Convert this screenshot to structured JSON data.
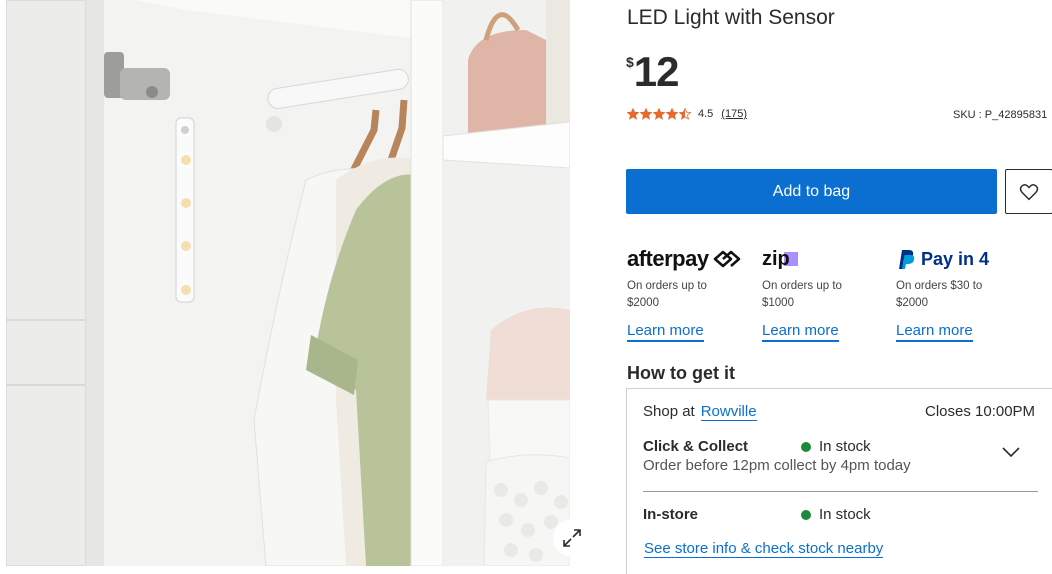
{
  "product": {
    "title": "LED Light with Sensor",
    "price_currency": "$",
    "price_amount": "12",
    "rating": "4.5",
    "rating_score": 4.5,
    "rating_count": "(175)",
    "sku": "SKU : P_42895831",
    "image_alt": "Wardrobe interior with LED sensor light bar"
  },
  "actions": {
    "add_to_bag_label": "Add to bag",
    "wishlist_icon": "heart-icon",
    "expand_icon": "expand-icon"
  },
  "payments": [
    {
      "provider": "afterpay",
      "terms_line1": "On orders up to",
      "terms_line2": "$2000",
      "link": "Learn more"
    },
    {
      "provider": "zip",
      "terms_line1": "On orders up to",
      "terms_line2": "$1000",
      "link": "Learn more"
    },
    {
      "provider": "paypal",
      "logo_text": "Pay in 4",
      "terms_line1": "On orders $30 to",
      "terms_line2": "$2000",
      "link": "Learn more"
    }
  ],
  "afterpay_logo_text": "afterpay",
  "zip_logo_text": "zip",
  "fulfilment": {
    "heading": "How to get it",
    "shop_at_label": "Shop at",
    "store_name": "Rowville",
    "closes": "Closes 10:00PM",
    "click_collect": {
      "title": "Click & Collect",
      "stock": "In stock",
      "detail": "Order before 12pm collect by 4pm today"
    },
    "in_store": {
      "title": "In-store",
      "stock": "In stock"
    },
    "store_info_link": "See store info & check stock nearby"
  },
  "colors": {
    "primary_blue": "#0a6fd1",
    "star_orange": "#e8692c",
    "in_stock_green": "#1c8a3a",
    "paypal_dark": "#003087",
    "paypal_light": "#009cde",
    "zip_purple": "#aa8fff"
  }
}
